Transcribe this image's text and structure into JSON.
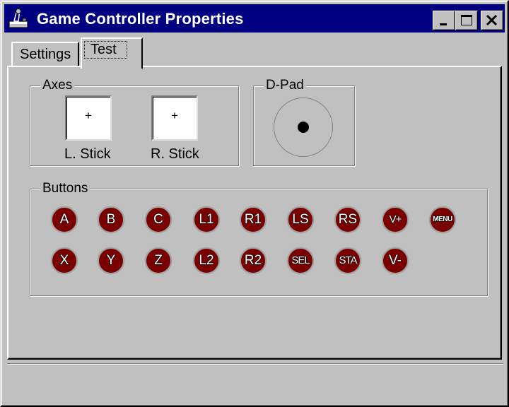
{
  "window": {
    "title": "Game Controller Properties",
    "icon": "joystick-icon",
    "controls": [
      "minimize-icon",
      "maximize-icon",
      "close-icon"
    ]
  },
  "tabs": [
    {
      "label": "Settings",
      "selected": false
    },
    {
      "label": "Test",
      "selected": true
    }
  ],
  "axes": {
    "label": "Axes",
    "left_stick": {
      "marker": "+",
      "label": "L. Stick"
    },
    "right_stick": {
      "marker": "+",
      "label": "R. Stick"
    }
  },
  "dpad": {
    "label": "D-Pad"
  },
  "buttons": {
    "label": "Buttons",
    "row1": [
      "A",
      "B",
      "C",
      "L1",
      "R1",
      "LS",
      "RS",
      "V+",
      "MENU"
    ],
    "row2": [
      "X",
      "Y",
      "Z",
      "L2",
      "R2",
      "SEL",
      "STA",
      "V-"
    ]
  },
  "colors": {
    "title_bar": "#000080",
    "button_fill": "#7a0000",
    "face": "#c0c0c0"
  }
}
